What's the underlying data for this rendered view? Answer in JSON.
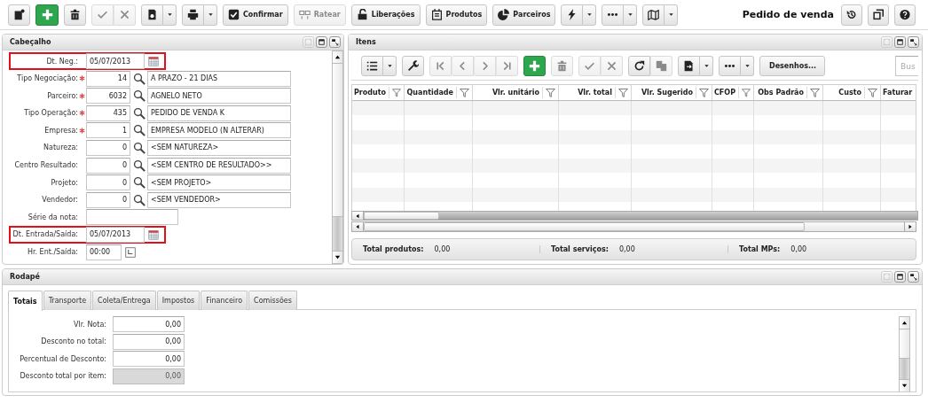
{
  "toolbar": {
    "buttons": [
      {
        "kind": "note",
        "disabled": false,
        "dropdown": false
      },
      {
        "kind": "add",
        "disabled": false,
        "dropdown": false
      },
      {
        "kind": "trash",
        "disabled": false,
        "dropdown": false
      },
      {
        "kind": "check",
        "disabled": true,
        "dropdown": false
      },
      {
        "kind": "cross",
        "disabled": true,
        "dropdown": false
      },
      {
        "kind": "report",
        "disabled": false,
        "dropdown": true
      },
      {
        "kind": "print",
        "disabled": false,
        "dropdown": true
      },
      {
        "kind": "checkbox",
        "label": "Confirmar",
        "disabled": false,
        "dropdown": false
      },
      {
        "kind": "split",
        "label": "Ratear",
        "disabled": true,
        "dropdown": false
      },
      {
        "kind": "lock",
        "label": "Liberações",
        "disabled": false,
        "dropdown": false
      },
      {
        "kind": "notepad",
        "label": "Produtos",
        "disabled": false,
        "dropdown": false
      },
      {
        "kind": "pie",
        "label": "Parceiros",
        "disabled": false,
        "dropdown": false
      },
      {
        "kind": "bolt",
        "disabled": false,
        "dropdown": true
      },
      {
        "kind": "dots",
        "disabled": false,
        "dropdown": true
      },
      {
        "kind": "map",
        "disabled": false,
        "dropdown": true
      }
    ],
    "title": "Pedido de venda",
    "actions": [
      {
        "kind": "history",
        "disabled": false,
        "dropdown": false
      },
      {
        "kind": "copy",
        "disabled": false,
        "dropdown": false
      },
      {
        "kind": "help",
        "disabled": false,
        "dropdown": false
      }
    ]
  },
  "header": {
    "title": "Cabeçalho",
    "fields": [
      {
        "kind": "date",
        "label": "Dt. Neg.:",
        "required": false,
        "highlighted": true,
        "value": "05/07/2013"
      },
      {
        "kind": "lookup",
        "label": "Tipo Negociação:",
        "required": true,
        "highlighted": false,
        "code": "14",
        "description": "A PRAZO - 21 DIAS"
      },
      {
        "kind": "lookup",
        "label": "Parceiro:",
        "required": true,
        "highlighted": false,
        "code": "6032",
        "description": "AGNELO NETO"
      },
      {
        "kind": "lookup",
        "label": "Tipo Operação:",
        "required": true,
        "highlighted": false,
        "code": "435",
        "description": "PEDIDO DE VENDA K"
      },
      {
        "kind": "lookup",
        "label": "Empresa:",
        "required": true,
        "highlighted": false,
        "code": "1",
        "description": "EMPRESA MODELO (N ALTERAR)"
      },
      {
        "kind": "lookup",
        "label": "Natureza:",
        "required": false,
        "highlighted": false,
        "code": "0",
        "description": "<SEM NATUREZA>"
      },
      {
        "kind": "lookup",
        "label": "Centro Resultado:",
        "required": false,
        "highlighted": false,
        "code": "0",
        "description": "<SEM CENTRO DE RESULTADO>>"
      },
      {
        "kind": "lookup",
        "label": "Projeto:",
        "required": false,
        "highlighted": false,
        "code": "0",
        "description": "<SEM PROJETO>"
      },
      {
        "kind": "lookup",
        "label": "Vendedor:",
        "required": false,
        "highlighted": false,
        "code": "0",
        "description": "<SEM VENDEDOR>"
      },
      {
        "kind": "text",
        "label": "Série da nota:",
        "required": false,
        "highlighted": false
      },
      {
        "kind": "date",
        "label": "Dt. Entrada/Saída:",
        "required": false,
        "highlighted": true,
        "value": "05/07/2013"
      },
      {
        "kind": "time",
        "label": "Hr. Ent./Saída:",
        "required": false,
        "highlighted": false,
        "value": "00:00"
      }
    ]
  },
  "items": {
    "title": "Itens",
    "toolbar": [
      {
        "kind": "listview",
        "disabled": false,
        "dropdown": true
      },
      {
        "kind": "wrench",
        "disabled": false,
        "dropdown": false
      },
      {
        "kind": "first",
        "disabled": true,
        "dropdown": false
      },
      {
        "kind": "prev",
        "disabled": true,
        "dropdown": false
      },
      {
        "kind": "next",
        "disabled": true,
        "dropdown": false
      },
      {
        "kind": "last",
        "disabled": true,
        "dropdown": false
      },
      {
        "kind": "add",
        "disabled": false,
        "dropdown": false
      },
      {
        "kind": "trash",
        "disabled": true,
        "dropdown": false
      },
      {
        "kind": "check",
        "disabled": true,
        "dropdown": false
      },
      {
        "kind": "cross",
        "disabled": true,
        "dropdown": false
      },
      {
        "kind": "refresh",
        "disabled": false,
        "dropdown": false
      },
      {
        "kind": "docs",
        "disabled": true,
        "dropdown": false
      },
      {
        "kind": "export",
        "disabled": false,
        "dropdown": true
      },
      {
        "kind": "dots",
        "disabled": false,
        "dropdown": true
      },
      {
        "kind": "text",
        "label": "Desenhos...",
        "disabled": false,
        "dropdown": false
      }
    ],
    "search": {
      "placeholder": "Bus"
    },
    "columns": [
      "Produto",
      "Quantidade",
      "Vlr. unitário",
      "Vlr. total",
      "Vlr. Sugerido",
      "CFOP",
      "Obs Padrão",
      "Custo",
      "Faturar"
    ],
    "totals": [
      {
        "label": "Total produtos:",
        "value": "0,00"
      },
      {
        "label": "Total serviços:",
        "value": "0,00"
      },
      {
        "label": "Total MPs:",
        "value": "0,00"
      }
    ]
  },
  "footer": {
    "title": "Rodapé",
    "tabs": [
      {
        "label": "Totais",
        "selected": true
      },
      {
        "label": "Transporte",
        "selected": false
      },
      {
        "label": "Coleta/Entrega",
        "selected": false
      },
      {
        "label": "Impostos",
        "selected": false
      },
      {
        "label": "Financeiro",
        "selected": false
      },
      {
        "label": "Comissões",
        "selected": false
      }
    ],
    "fields": [
      {
        "label": "Vlr. Nota:",
        "value": "0,00",
        "disabled": false
      },
      {
        "label": "Desconto no total:",
        "value": "0,00",
        "disabled": false
      },
      {
        "label": "Percentual de Desconto:",
        "value": "0,00",
        "disabled": false
      },
      {
        "label": "Desconto total por item:",
        "value": "0,00",
        "disabled": true
      }
    ]
  }
}
